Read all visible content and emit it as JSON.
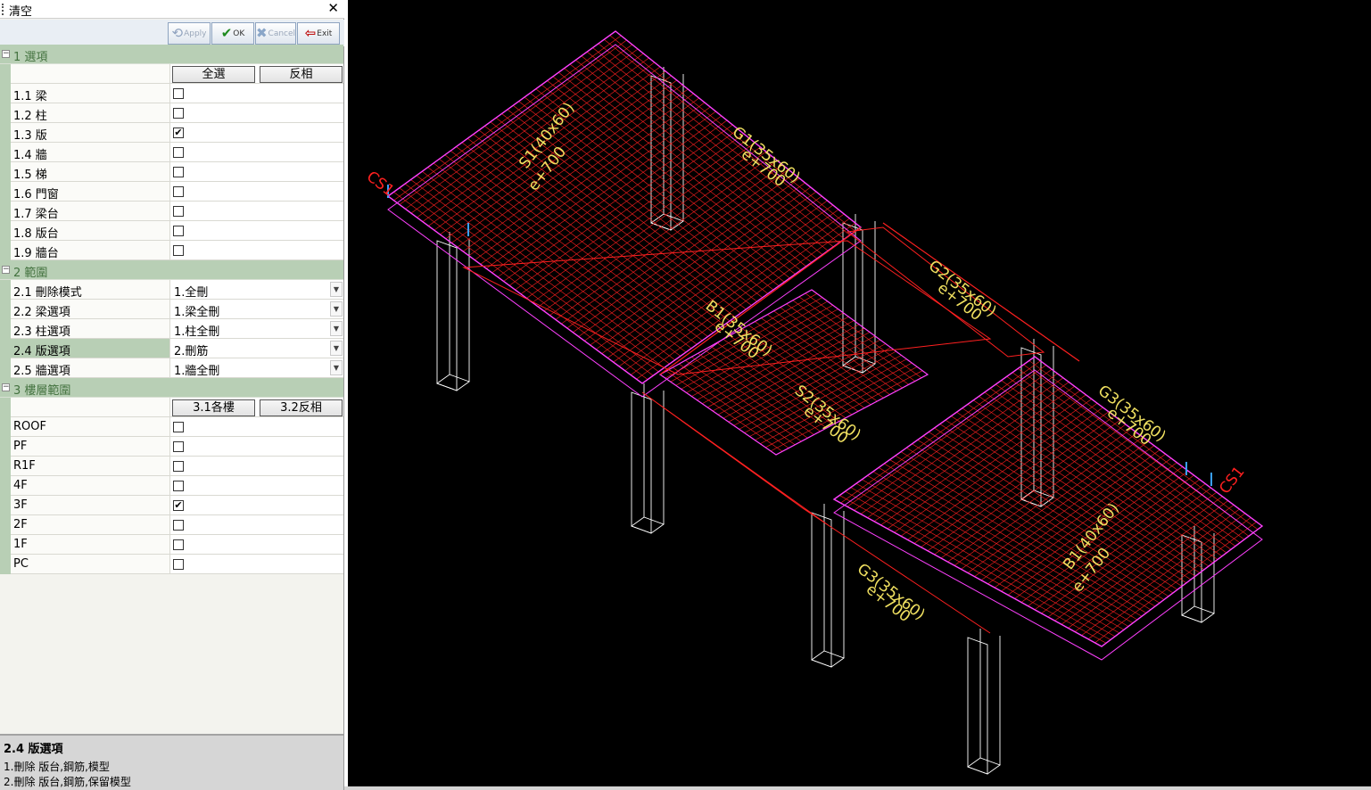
{
  "window": {
    "title": "清空",
    "close_glyph": "✕"
  },
  "toolbar": {
    "apply_label": "Apply",
    "ok_label": "OK",
    "cancel_label": "Cancel",
    "exit_label": "Exit"
  },
  "section1": {
    "title": "1 選項",
    "select_all": "全選",
    "invert": "反相",
    "items": [
      {
        "label": "1.1 梁",
        "checked": false
      },
      {
        "label": "1.2 柱",
        "checked": false
      },
      {
        "label": "1.3 版",
        "checked": true
      },
      {
        "label": "1.4 牆",
        "checked": false
      },
      {
        "label": "1.5 梯",
        "checked": false
      },
      {
        "label": "1.6 門窗",
        "checked": false
      },
      {
        "label": "1.7 梁台",
        "checked": false
      },
      {
        "label": "1.8 版台",
        "checked": false
      },
      {
        "label": "1.9 牆台",
        "checked": false
      }
    ]
  },
  "section2": {
    "title": "2 範圍",
    "items": [
      {
        "label": "2.1 刪除模式",
        "value": "1.全刪"
      },
      {
        "label": "2.2 梁選項",
        "value": "1.梁全刪"
      },
      {
        "label": "2.3 柱選項",
        "value": "1.柱全刪"
      },
      {
        "label": "2.4 版選項",
        "value": "2.刪筋"
      },
      {
        "label": "2.5 牆選項",
        "value": "1.牆全刪"
      }
    ]
  },
  "section3": {
    "title": "3 樓層範圍",
    "each_floor": "3.1各樓",
    "invert": "3.2反相",
    "items": [
      {
        "label": "ROOF",
        "checked": false
      },
      {
        "label": "PF",
        "checked": false
      },
      {
        "label": "R1F",
        "checked": false
      },
      {
        "label": "4F",
        "checked": false
      },
      {
        "label": "3F",
        "checked": true
      },
      {
        "label": "2F",
        "checked": false
      },
      {
        "label": "1F",
        "checked": false
      },
      {
        "label": "PC",
        "checked": false
      }
    ]
  },
  "description": {
    "title": "2.4 版選項",
    "lines": [
      "1.刪除 版台,鋼筋,模型",
      "2.刪除 版台,鋼筋,保留模型"
    ]
  },
  "viewport": {
    "labels": [
      "G1(35x60)",
      "e+700",
      "G2(35x60)",
      "e+700",
      "G3(35x60)",
      "e+700",
      "B1(35x60)",
      "e+700",
      "S1(40x60)",
      "e+700",
      "G3(35x60)",
      "e+700",
      "B1(40x60)",
      "e+700",
      "S2(35x60)",
      "e+700",
      "CS1",
      "CS1"
    ],
    "colors": {
      "background": "#000000",
      "beam": "#ff2020",
      "slab_edge": "#ff40ff",
      "column": "#ffffff",
      "label": "#f0e060"
    }
  }
}
